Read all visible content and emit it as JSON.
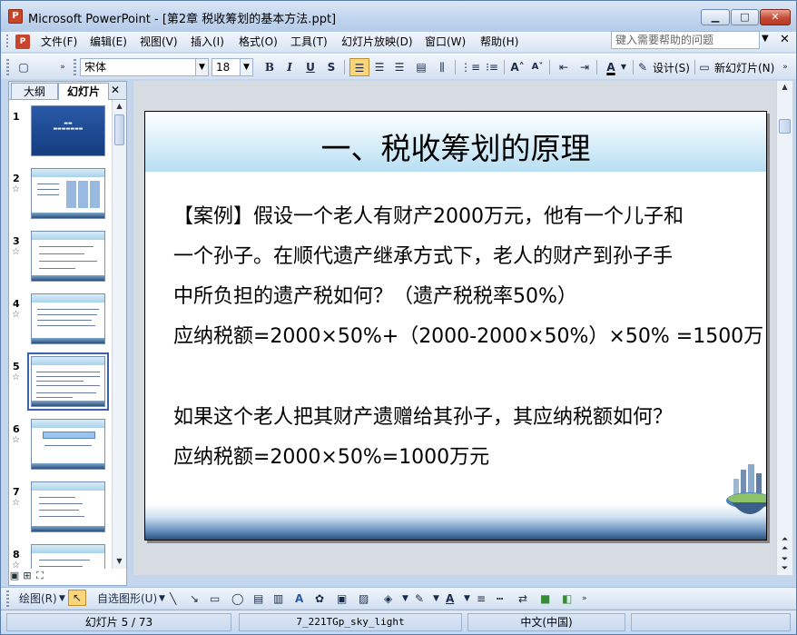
{
  "window": {
    "title": "Microsoft PowerPoint - [第2章 税收筹划的基本方法.ppt]",
    "app_icon": "P",
    "min_glyph": "▁",
    "max_glyph": "□",
    "close_glyph": "✕"
  },
  "menu": {
    "items": [
      "文件(F)",
      "编辑(E)",
      "视图(V)",
      "插入(I)",
      "格式(O)",
      "工具(T)",
      "幻灯片放映(D)",
      "窗口(W)",
      "帮助(H)"
    ],
    "help_placeholder": "键入需要帮助的问题",
    "help_arrow": "▼",
    "doc_close": "✕"
  },
  "toolbar": {
    "font_name": "宋体",
    "font_size": "18",
    "bold": "B",
    "italic": "I",
    "underline": "U",
    "shadow": "S",
    "font_color": "A",
    "design_label": "设计(S)",
    "new_slide_label": "新幻灯片(N)"
  },
  "left_pane": {
    "tab_outline": "大纲",
    "tab_slides": "幻灯片",
    "close": "✕",
    "slides": [
      {
        "num": "1",
        "star": ""
      },
      {
        "num": "2",
        "star": "☆"
      },
      {
        "num": "3",
        "star": "☆"
      },
      {
        "num": "4",
        "star": "☆"
      },
      {
        "num": "5",
        "star": "☆"
      },
      {
        "num": "6",
        "star": "☆"
      },
      {
        "num": "7",
        "star": "☆"
      },
      {
        "num": "8",
        "star": "☆"
      }
    ],
    "selected_slide": 5
  },
  "slide": {
    "title": "一、税收筹划的原理",
    "lines": [
      "【案例】假设一个老人有财产2000万元，他有一个儿子和",
      "一个孙子。在顺代遗产继承方式下，老人的财产到孙子手",
      "中所负担的遗产税如何？（遗产税税率50%）",
      "应纳税额=2000×50%+（2000-2000×50%）×50% =1500万",
      "如果这个老人把其财产遗赠给其孙子，其应纳税额如何？",
      "应纳税额=2000×50%=1000万元"
    ]
  },
  "drawbar": {
    "draw_label": "绘图(R)",
    "autoshapes_label": "自选图形(U)"
  },
  "status": {
    "slide_position": "幻灯片 5 / 73",
    "template": "7_221TGp_sky_light",
    "language": "中文(中国)"
  }
}
